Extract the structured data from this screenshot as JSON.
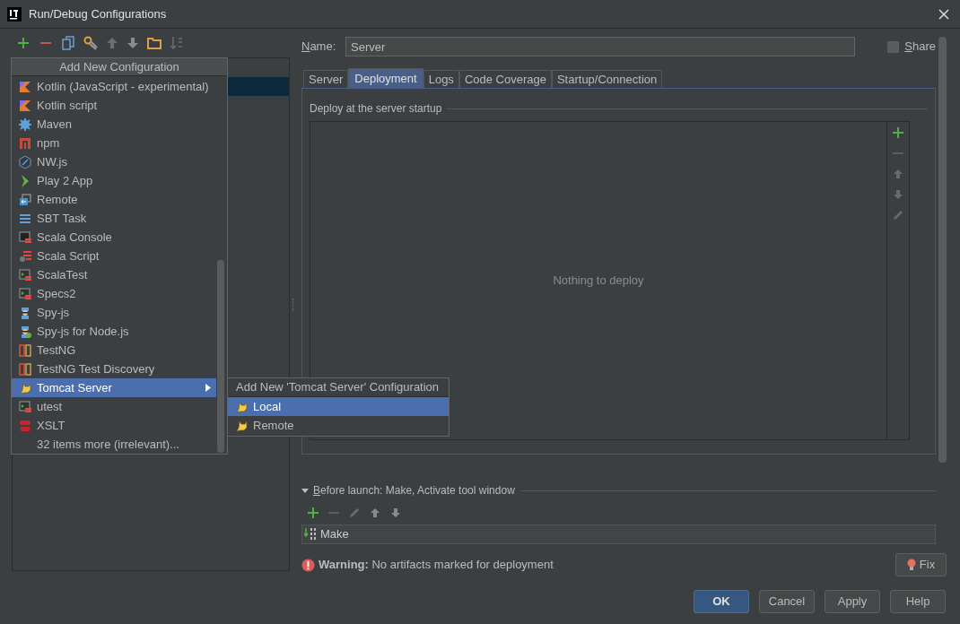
{
  "window": {
    "title": "Run/Debug Configurations"
  },
  "add_menu": {
    "title": "Add New Configuration",
    "items": [
      {
        "label": "Kotlin (JavaScript - experimental)",
        "kind": "entry",
        "selected": false,
        "submenu": false
      },
      {
        "label": "Kotlin script",
        "kind": "entry",
        "selected": false,
        "submenu": false
      },
      {
        "label": "Maven",
        "kind": "entry",
        "selected": false,
        "submenu": false
      },
      {
        "label": "npm",
        "kind": "entry",
        "selected": false,
        "submenu": false
      },
      {
        "label": "NW.js",
        "kind": "entry",
        "selected": false,
        "submenu": false
      },
      {
        "label": "Play 2 App",
        "kind": "entry",
        "selected": false,
        "submenu": false
      },
      {
        "label": "Remote",
        "kind": "entry",
        "selected": false,
        "submenu": false
      },
      {
        "label": "SBT Task",
        "kind": "entry",
        "selected": false,
        "submenu": false
      },
      {
        "label": "Scala Console",
        "kind": "entry",
        "selected": false,
        "submenu": false
      },
      {
        "label": "Scala Script",
        "kind": "entry",
        "selected": false,
        "submenu": false
      },
      {
        "label": "ScalaTest",
        "kind": "entry",
        "selected": false,
        "submenu": false
      },
      {
        "label": "Specs2",
        "kind": "entry",
        "selected": false,
        "submenu": false
      },
      {
        "label": "Spy-js",
        "kind": "entry",
        "selected": false,
        "submenu": false
      },
      {
        "label": "Spy-js for Node.js",
        "kind": "entry",
        "selected": false,
        "submenu": false
      },
      {
        "label": "TestNG",
        "kind": "entry",
        "selected": false,
        "submenu": false
      },
      {
        "label": "TestNG Test Discovery",
        "kind": "entry",
        "selected": false,
        "submenu": false
      },
      {
        "label": "Tomcat Server",
        "kind": "entry",
        "selected": true,
        "submenu": true
      },
      {
        "label": "utest",
        "kind": "entry",
        "selected": false,
        "submenu": false
      },
      {
        "label": "XSLT",
        "kind": "entry",
        "selected": false,
        "submenu": false
      },
      {
        "label": "32 items more (irrelevant)...",
        "kind": "more",
        "selected": false,
        "submenu": false
      }
    ]
  },
  "submenu": {
    "title": "Add New 'Tomcat Server' Configuration",
    "items": [
      {
        "label": "Local",
        "selected": true
      },
      {
        "label": "Remote",
        "selected": false
      }
    ]
  },
  "name_field": {
    "label": "Name:",
    "value": "Server"
  },
  "share": {
    "label": "Share",
    "checked": false
  },
  "tabs": [
    {
      "label": "Server",
      "selected": false
    },
    {
      "label": "Deployment",
      "selected": true
    },
    {
      "label": "Logs",
      "selected": false
    },
    {
      "label": "Code Coverage",
      "selected": false
    },
    {
      "label": "Startup/Connection",
      "selected": false
    }
  ],
  "deploy_group": {
    "title": "Deploy at the server startup",
    "empty_text": "Nothing to deploy"
  },
  "before_launch": {
    "title": "Before launch: Make, Activate tool window",
    "expanded": true,
    "tasks": [
      "Make"
    ]
  },
  "warning": {
    "text": "**Warning:** No artifacts marked for deployment"
  },
  "fix_button": "Fix",
  "buttons": [
    {
      "label": "OK",
      "default": true
    },
    {
      "label": "Cancel",
      "default": false
    },
    {
      "label": "Apply",
      "default": false
    },
    {
      "label": "Help",
      "default": false
    }
  ]
}
